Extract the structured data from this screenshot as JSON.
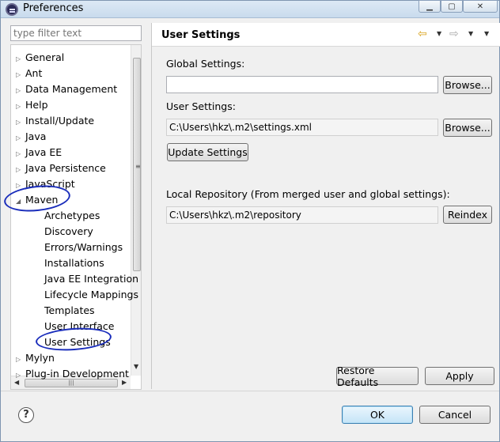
{
  "window": {
    "title": "Preferences"
  },
  "filter": {
    "placeholder": "type filter text"
  },
  "tree": {
    "items": [
      {
        "label": "General",
        "expanded": false
      },
      {
        "label": "Ant",
        "expanded": false
      },
      {
        "label": "Data Management",
        "expanded": false
      },
      {
        "label": "Help",
        "expanded": false
      },
      {
        "label": "Install/Update",
        "expanded": false
      },
      {
        "label": "Java",
        "expanded": false
      },
      {
        "label": "Java EE",
        "expanded": false
      },
      {
        "label": "Java Persistence",
        "expanded": false
      },
      {
        "label": "JavaScript",
        "expanded": false
      },
      {
        "label": "Maven",
        "expanded": true
      },
      {
        "label": "Archetypes",
        "child": true
      },
      {
        "label": "Discovery",
        "child": true
      },
      {
        "label": "Errors/Warnings",
        "child": true
      },
      {
        "label": "Installations",
        "child": true
      },
      {
        "label": "Java EE Integration",
        "child": true
      },
      {
        "label": "Lifecycle Mappings",
        "child": true
      },
      {
        "label": "Templates",
        "child": true
      },
      {
        "label": "User Interface",
        "child": true
      },
      {
        "label": "User Settings",
        "child": true,
        "selected": true
      },
      {
        "label": "Mylyn",
        "expanded": false
      },
      {
        "label": "Plug-in Development",
        "expanded": false
      }
    ]
  },
  "page": {
    "title": "User Settings",
    "global_label": "Global Settings:",
    "global_value": "",
    "browse1": "Browse...",
    "user_label": "User Settings:",
    "user_value": "C:\\Users\\hkz\\.m2\\settings.xml",
    "browse2": "Browse...",
    "update_button": "Update Settings",
    "repo_label": "Local Repository (From merged user and global settings):",
    "repo_value": "C:\\Users\\hkz\\.m2\\repository",
    "reindex_button": "Reindex",
    "restore_button": "Restore Defaults",
    "apply_button": "Apply"
  },
  "footer": {
    "ok": "OK",
    "cancel": "Cancel"
  },
  "colors": {
    "annotation": "#1a2dbb"
  }
}
